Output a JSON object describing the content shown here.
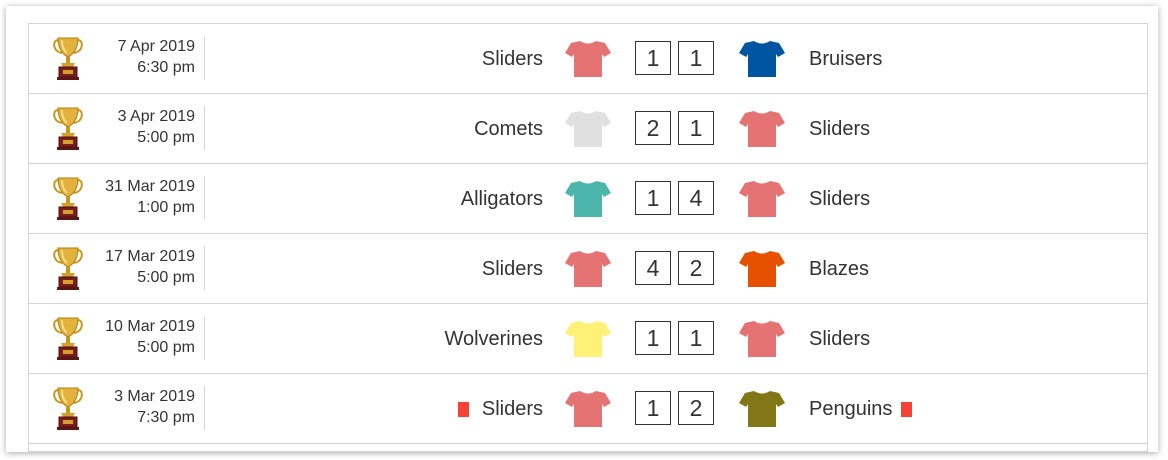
{
  "matches": [
    {
      "date": "7 Apr 2019",
      "time": "6:30 pm",
      "home": "Sliders",
      "home_score": "1",
      "away_score": "1",
      "away": "Bruisers",
      "home_color": "#e57373",
      "away_color": "#0055a0",
      "home_card": false,
      "away_card": false
    },
    {
      "date": "3 Apr 2019",
      "time": "5:00 pm",
      "home": "Comets",
      "home_score": "2",
      "away_score": "1",
      "away": "Sliders",
      "home_color": "#e0e0e0",
      "away_color": "#e57373",
      "home_card": false,
      "away_card": false
    },
    {
      "date": "31 Mar 2019",
      "time": "1:00 pm",
      "home": "Alligators",
      "home_score": "1",
      "away_score": "4",
      "away": "Sliders",
      "home_color": "#4db6ac",
      "away_color": "#e57373",
      "home_card": false,
      "away_card": false
    },
    {
      "date": "17 Mar 2019",
      "time": "5:00 pm",
      "home": "Sliders",
      "home_score": "4",
      "away_score": "2",
      "away": "Blazes",
      "home_color": "#e57373",
      "away_color": "#e65100",
      "home_card": false,
      "away_card": false
    },
    {
      "date": "10 Mar 2019",
      "time": "5:00 pm",
      "home": "Wolverines",
      "home_score": "1",
      "away_score": "1",
      "away": "Sliders",
      "home_color": "#fff176",
      "away_color": "#e57373",
      "home_card": false,
      "away_card": false
    },
    {
      "date": "3 Mar 2019",
      "time": "7:30 pm",
      "home": "Sliders",
      "home_score": "1",
      "away_score": "2",
      "away": "Penguins",
      "home_color": "#e57373",
      "away_color": "#827717",
      "home_card": true,
      "away_card": true
    }
  ],
  "card_color": "#f44336",
  "icons": {
    "trophy": "trophy-icon",
    "shirt": "shirt-icon",
    "card": "red-card-icon"
  }
}
